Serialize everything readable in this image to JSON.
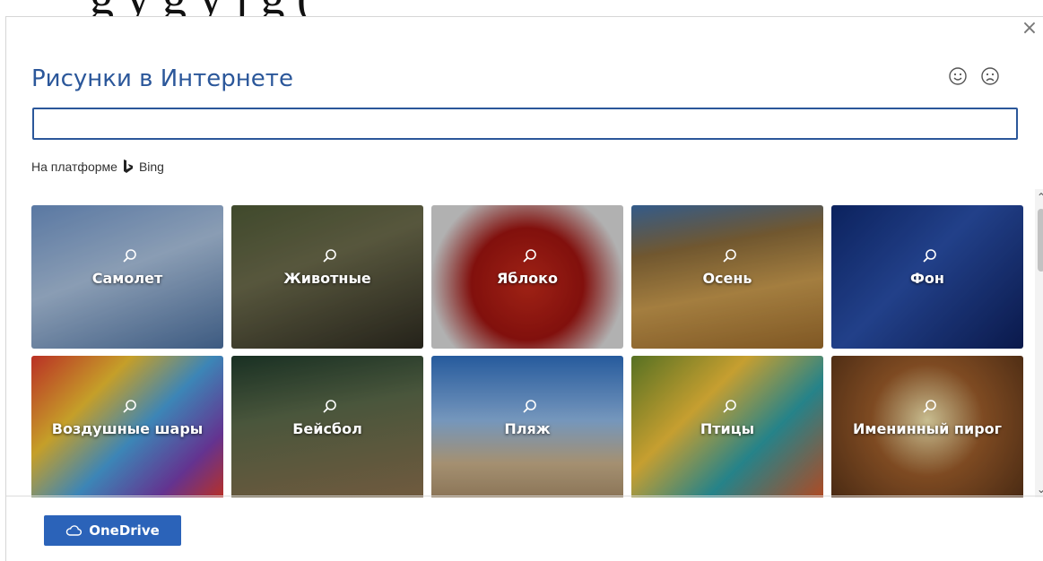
{
  "background_document": {
    "text": "g  y  g      y j           g  ("
  },
  "dialog": {
    "title": "Рисунки в Интернете",
    "close_icon": "×",
    "feedback": {
      "smile_icon": "smile-face-icon",
      "frown_icon": "frown-face-icon"
    },
    "search": {
      "value": "",
      "placeholder": ""
    },
    "powered_by": {
      "label": "На платформе",
      "provider": "Bing"
    },
    "tiles": [
      {
        "label": "Самолет",
        "bg": "linear-gradient(160deg,#6e93c7 0%,#a9c0dc 45%,#4b6f9e 100%)"
      },
      {
        "label": "Животные",
        "bg": "linear-gradient(160deg,#4e5a36 0%,#6b6a4b 40%,#2d2a20 100%)"
      },
      {
        "label": "Яблоко",
        "bg": "radial-gradient(circle at 50% 55%,#c22a1a 0%,#9e1410 45%,#d8d8d8 78%)"
      },
      {
        "label": "Осень",
        "bg": "linear-gradient(170deg,#3f6fa8 0%,#8a6b3a 30%,#c89a4e 60%,#9c6b2c 100%)"
      },
      {
        "label": "Фон",
        "bg": "linear-gradient(135deg,#0f2a73 0%,#2a4fa8 45%,#0d1f5c 100%)"
      },
      {
        "label": "Воздушные шары",
        "bg": "linear-gradient(135deg,#e33b2e 0%,#f1c232 30%,#4aa3df 55%,#7a3fb0 80%,#e33b2e 100%)"
      },
      {
        "label": "Бейсбол",
        "bg": "linear-gradient(170deg,#1f3b2b 0%,#5b6a4a 40%,#8a6e4c 100%)"
      },
      {
        "label": "Пляж",
        "bg": "linear-gradient(180deg,#2f6fc0 0%,#8fb8e6 45%,#c9b08a 75%,#a98e6a 100%)"
      },
      {
        "label": "Птицы",
        "bg": "linear-gradient(135deg,#6a8a2b 0%,#f2c23b 35%,#2ea0a8 65%,#d85a2a 100%)"
      },
      {
        "label": "Именинный пирог",
        "bg": "radial-gradient(circle at 50% 45%,#f4e7b0 0%,#9a5b2a 45%,#5a3418 100%)"
      }
    ],
    "scroll": {
      "up": "⌃",
      "down": "⌄"
    },
    "onedrive_button": {
      "label": "OneDrive",
      "icon": "cloud-icon"
    }
  },
  "colors": {
    "accent": "#2b579a",
    "button": "#2b63b9"
  }
}
